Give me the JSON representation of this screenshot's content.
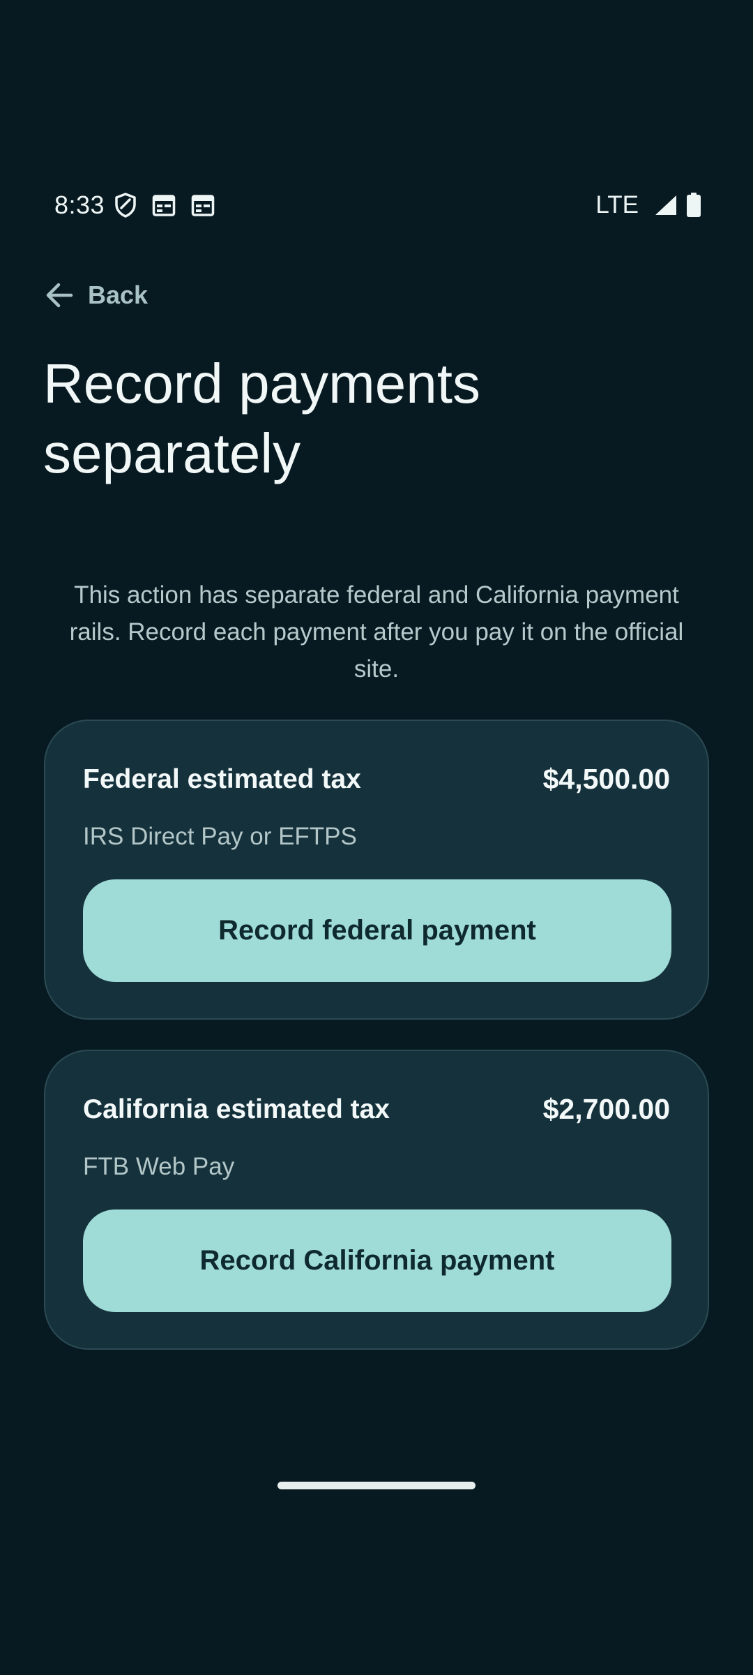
{
  "status_bar": {
    "time": "8:33",
    "network": "LTE",
    "icons": [
      "shield-icon",
      "calendar-icon",
      "calendar-icon",
      "signal-icon",
      "battery-icon"
    ]
  },
  "nav": {
    "back_label": "Back"
  },
  "page": {
    "title": "Record payments separately",
    "description": "This action has separate federal and California payment rails. Record each payment after you pay it on the official site."
  },
  "payments": [
    {
      "title": "Federal estimated tax",
      "amount": "$4,500.00",
      "method": "IRS Direct Pay or EFTPS",
      "button_label": "Record federal payment"
    },
    {
      "title": "California estimated tax",
      "amount": "$2,700.00",
      "method": "FTB Web Pay",
      "button_label": "Record California payment"
    }
  ],
  "colors": {
    "background": "#081a21",
    "card": "#15323c",
    "button": "#9fdbd7",
    "button_text": "#0f2a2e"
  }
}
